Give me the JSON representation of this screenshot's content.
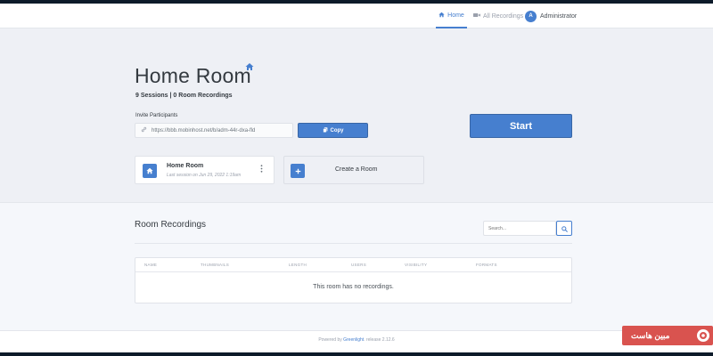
{
  "colors": {
    "accent": "#467fcf",
    "hero_bg": "#eef0f5",
    "watermark": "#d9534f"
  },
  "nav": {
    "home_label": "Home",
    "home_icon": "home-icon",
    "recordings_label": "All Recordings",
    "recordings_icon": "video-icon",
    "user_initial": "A",
    "user_name": "Administrator"
  },
  "room": {
    "title": "Home Room",
    "subtitle": "9 Sessions | 0 Room Recordings",
    "invite_label": "Invite Participants",
    "invite_url": "https://bbb.mobinhost.net/b/adm-44r-dxa-fld",
    "copy_label": "Copy",
    "start_label": "Start"
  },
  "room_card": {
    "name": "Home Room",
    "last_session": "Last session on Jun 29, 2022 1:19am"
  },
  "create_room_label": "Create a Room",
  "recordings": {
    "title": "Room Recordings",
    "search_placeholder": "Search...",
    "columns": [
      "NAME",
      "THUMBNAILS",
      "LENGTH",
      "USERS",
      "VISIBILITY",
      "FORMATS"
    ],
    "empty_message": "This room has no recordings."
  },
  "footer": {
    "prefix": "Powered by",
    "brand": "Greenlight",
    "suffix": ". release 2.12.6"
  },
  "watermark": {
    "text": "مبین هاست"
  }
}
